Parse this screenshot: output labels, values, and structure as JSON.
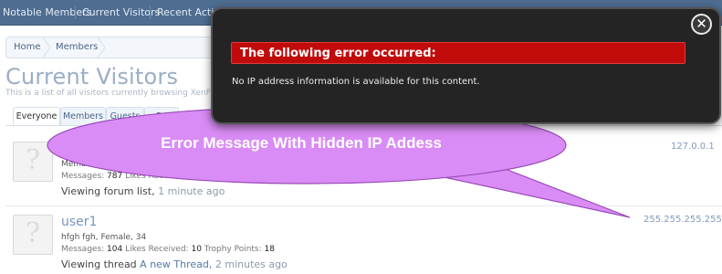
{
  "nav": {
    "items": [
      "Notable Members",
      "Current Visitors",
      "Recent Acti"
    ]
  },
  "breadcrumb": [
    "Home",
    "Members"
  ],
  "page": {
    "title": "Current Visitors",
    "description": "This is a list of all visitors currently browsing XenForo..."
  },
  "tabs": [
    "Everyone",
    "Members",
    "Guests",
    "Ro"
  ],
  "visitors": [
    {
      "name": "",
      "subtitle": "Member",
      "stats": {
        "messages_label": "Messages:",
        "messages": "787",
        "likes_label": "Likes Received:"
      },
      "activity": "Viewing forum list,",
      "time": "1 minute ago",
      "ip": "127.0.0.1"
    },
    {
      "name": "user1",
      "subtitle": "hfgh fgh, Female, 34",
      "stats": {
        "messages_label": "Messages:",
        "messages": "104",
        "likes_label": "Likes Received:",
        "likes": "10",
        "trophy_label": "Trophy Points:",
        "trophy": "18"
      },
      "activity": "Viewing thread",
      "activity_link": "A new Thread,",
      "time": "2 minutes ago",
      "ip": "255.255.255.255"
    }
  ],
  "error": {
    "heading": "The following error occurred:",
    "message": "No IP address information is available for this content.",
    "close_glyph": "✕"
  },
  "callout": {
    "text": "Error Message With Hidden IP Addess"
  },
  "colors": {
    "nav": "#4e6d91",
    "error_red": "#c10b0b",
    "overlay": "#242424",
    "callout": "#d98cf5"
  }
}
